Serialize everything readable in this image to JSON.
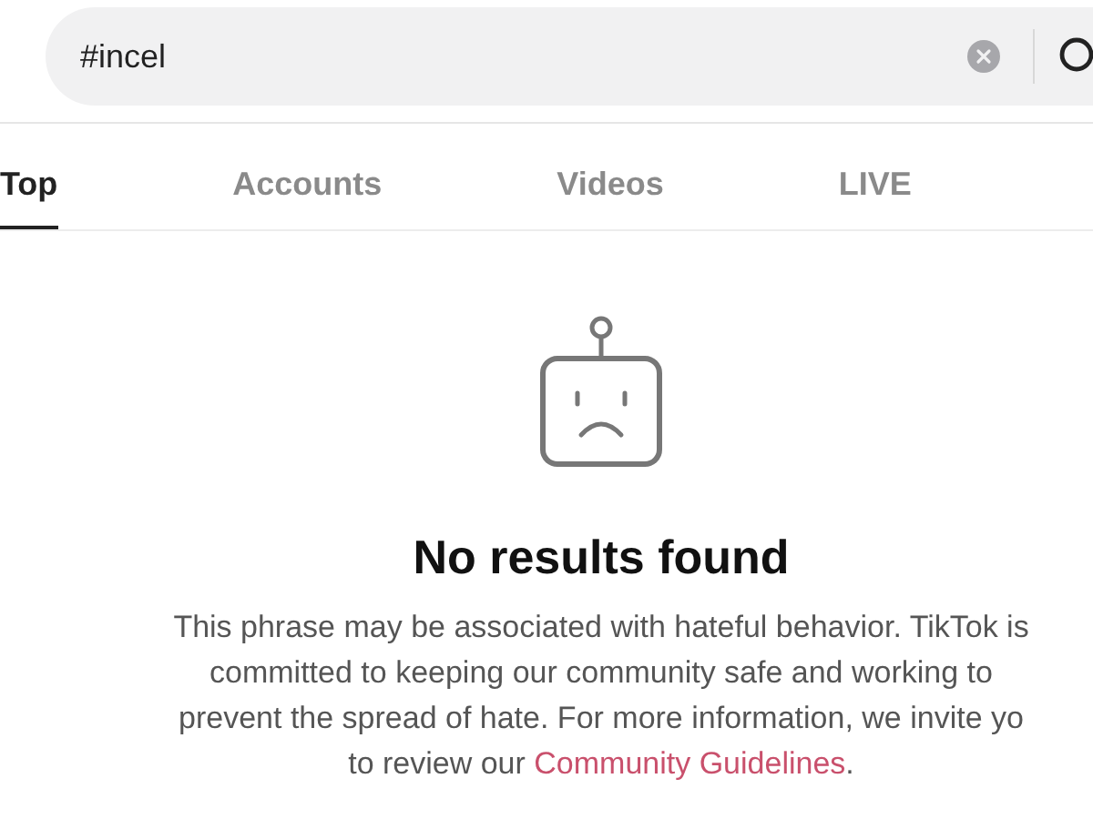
{
  "search": {
    "value": "#incel"
  },
  "tabs": [
    {
      "label": "Top",
      "selected": true
    },
    {
      "label": "Accounts",
      "selected": false
    },
    {
      "label": "Videos",
      "selected": false
    },
    {
      "label": "LIVE",
      "selected": false
    }
  ],
  "empty_state": {
    "title": "No results found",
    "lines": [
      "This phrase may be associated with hateful behavior. TikTok is",
      "committed to keeping our community safe and working to",
      "prevent the spread of hate. For more information, we invite yo",
      "to review our "
    ],
    "link": "Community Guidelines",
    "end": "."
  }
}
